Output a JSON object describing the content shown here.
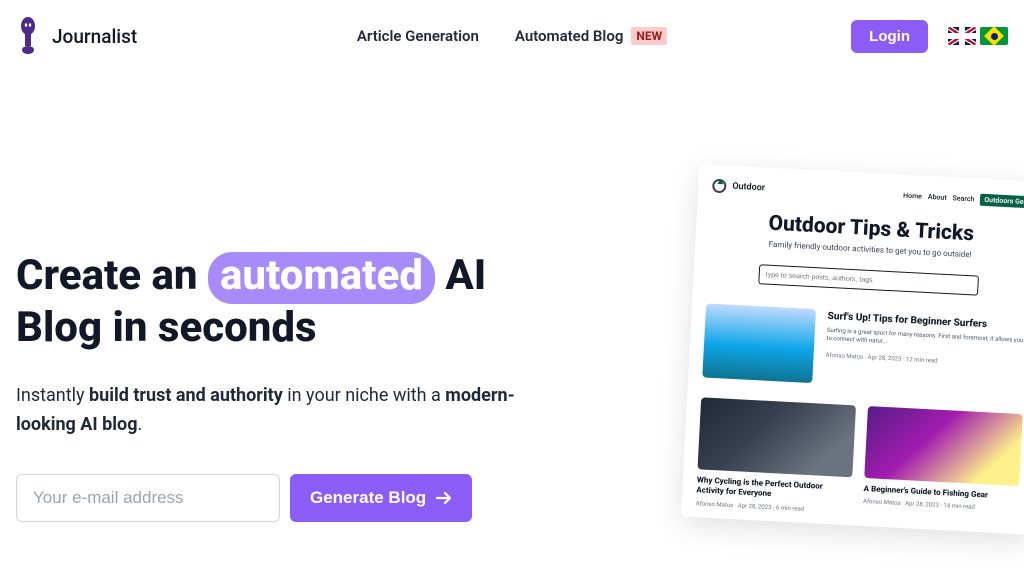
{
  "brand": "Journalist",
  "nav": {
    "item1": "Article Generation",
    "item2": "Automated Blog",
    "badge": "NEW"
  },
  "login": "Login",
  "hero": {
    "title_pre": "Create an ",
    "title_highlight": "automated",
    "title_post": " AI Blog in seconds",
    "sub_pre": "Instantly ",
    "sub_bold1": "build trust and authority",
    "sub_mid": " in your niche with a ",
    "sub_bold2": "modern-looking AI blog",
    "sub_end": "."
  },
  "cta": {
    "placeholder": "Your e-mail address",
    "button": "Generate Blog"
  },
  "preview": {
    "brand": "Outdoor",
    "nav": {
      "home": "Home",
      "about": "About",
      "search": "Search",
      "gear": "Outdoors Gear"
    },
    "title": "Outdoor Tips & Tricks",
    "sub": "Family friendly outdoor activities to get you to go outside!",
    "search_placeholder": "type to search posts, authors, tags",
    "post1": {
      "title": "Surf's Up! Tips for Beginner Surfers",
      "desc": "Surfing is a great sport for many reasons. First and foremost, it allows you to connect with natur...",
      "meta": "Afonso Matos · Apr 28, 2023 · 12 min read"
    },
    "post2": {
      "title": "Why Cycling is the Perfect Outdoor Activity for Everyone",
      "meta": "Afonso Matos · Apr 28, 2023 · 6 min read"
    },
    "post3": {
      "title": "A Beginner's Guide to Fishing Gear",
      "meta": "Afonso Matos · Apr 28, 2023 · 14 min read"
    }
  }
}
